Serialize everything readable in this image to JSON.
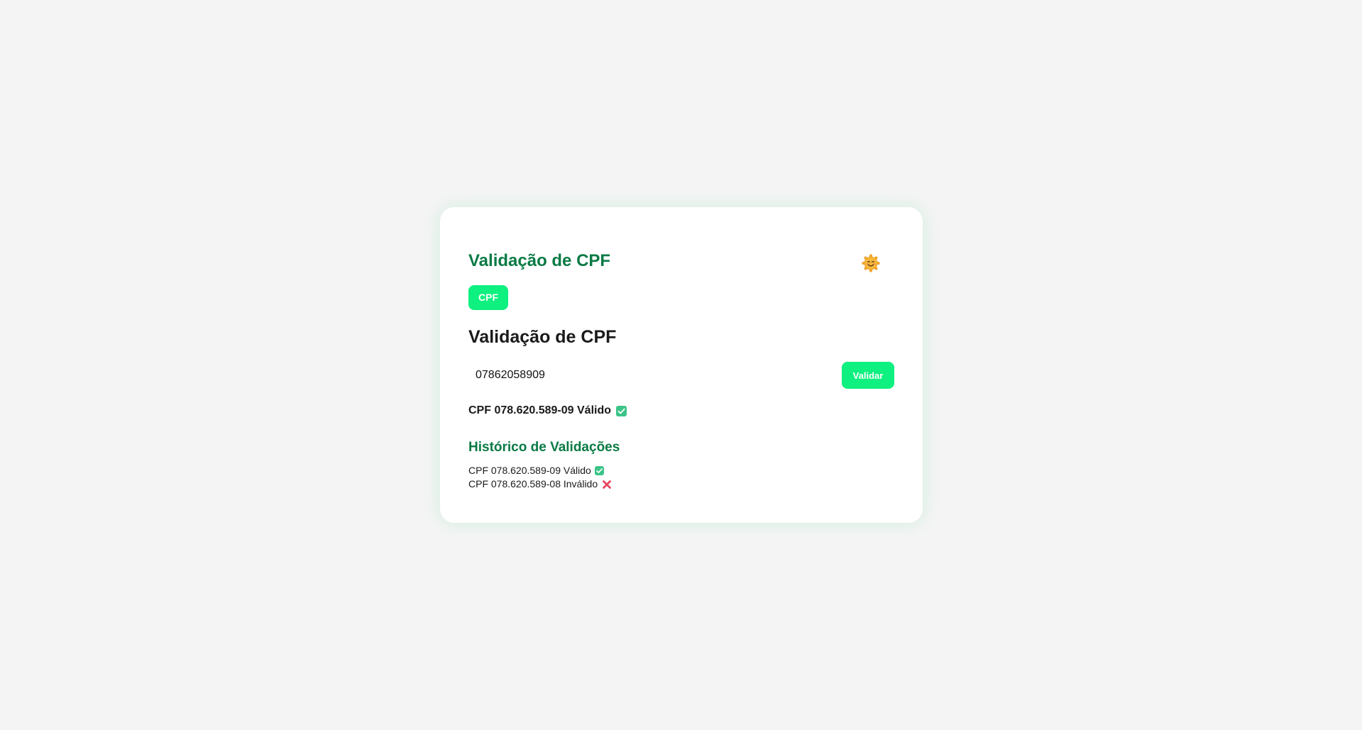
{
  "header": {
    "title": "Validação de CPF",
    "emoji_icon": "smiling-face-icon"
  },
  "tabs": [
    {
      "label": "CPF",
      "active": true
    }
  ],
  "section": {
    "title": "Validação de CPF"
  },
  "form": {
    "input_value": "07862058909",
    "button_label": "Validar"
  },
  "result": {
    "text": "CPF 078.620.589-09 Válido",
    "icon": "check-mark-icon"
  },
  "history": {
    "title": "Histórico de Validações",
    "items": [
      {
        "text": "CPF 078.620.589-09 Válido",
        "icon": "check-mark-icon"
      },
      {
        "text": "CPF 078.620.589-08 Inválido",
        "icon": "cross-mark-icon"
      }
    ]
  },
  "colors": {
    "accent": "#0ef07f",
    "title_green": "#0a7a45",
    "background": "#f4f4f4",
    "check_green": "#3cc488",
    "cross_red": "#e8455f"
  }
}
